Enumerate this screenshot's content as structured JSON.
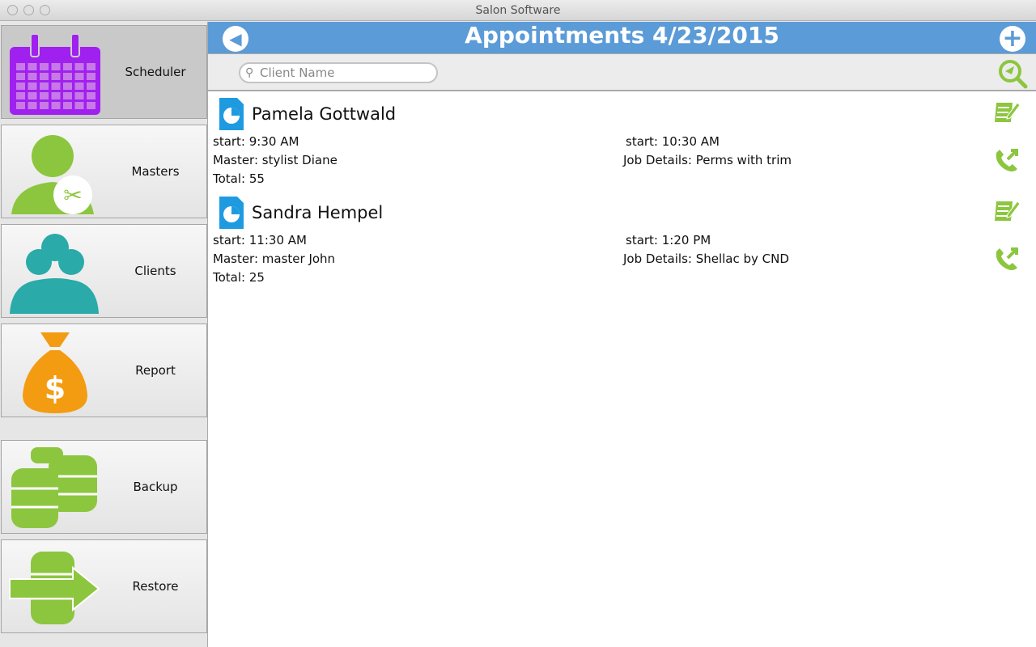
{
  "window": {
    "title": "Salon Software"
  },
  "sidebar": {
    "items": [
      {
        "label": "Scheduler"
      },
      {
        "label": "Masters"
      },
      {
        "label": "Clients"
      },
      {
        "label": "Report"
      },
      {
        "label": "Backup"
      },
      {
        "label": "Restore"
      }
    ]
  },
  "header": {
    "title": "Appointments 4/23/2015"
  },
  "search": {
    "placeholder": "Client Name"
  },
  "appointments": [
    {
      "client": "Pamela Gottwald",
      "start": "start: 9:30 AM",
      "end": "start: 10:30 AM",
      "master": "Master: stylist Diane",
      "job": "Job Details: Perms with trim",
      "total": "Total: 55"
    },
    {
      "client": "Sandra Hempel",
      "start": "start: 11:30 AM",
      "end": "start: 1:20 PM",
      "master": "Master: master John",
      "job": "Job Details: Shellac by CND",
      "total": "Total: 25"
    }
  ],
  "colors": {
    "header": "#5b9bd7",
    "green": "#8cc63f",
    "purple": "#a020f0",
    "teal": "#2aaaa8",
    "orange": "#f39c12",
    "blue": "#1e9be0"
  }
}
